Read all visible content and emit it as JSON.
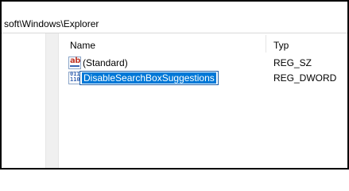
{
  "address_bar": {
    "path": "soft\\Windows\\Explorer"
  },
  "columns": {
    "name": "Name",
    "type": "Typ"
  },
  "values": [
    {
      "icon": "string-value-icon",
      "icon_text": "ab",
      "name": "(Standard)",
      "type": "REG_SZ"
    },
    {
      "icon": "dword-value-icon",
      "icon_text": "011 110",
      "name": "DisableSearchBoxSuggestions",
      "type": "REG_DWORD",
      "editing": true
    }
  ],
  "colors": {
    "selection": "#0078d7",
    "edit_border": "#1e5fa8",
    "string_icon": "#c0392b",
    "binary_icon": "#3a66b3"
  }
}
